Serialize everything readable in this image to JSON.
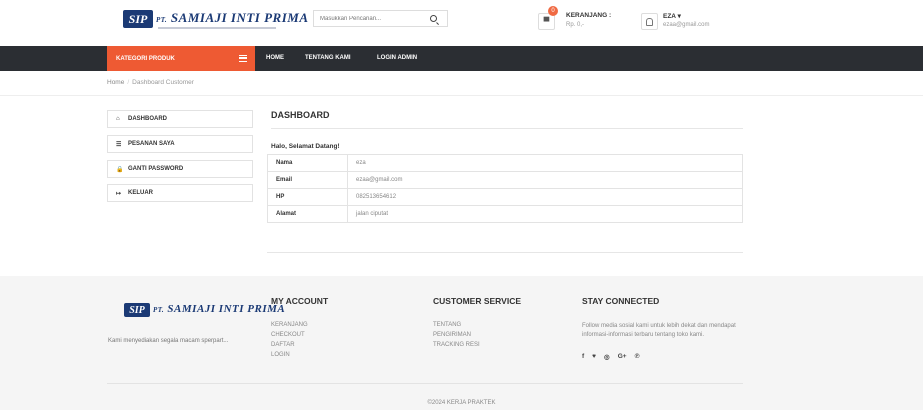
{
  "header": {
    "logo_box": "SIP",
    "logo_prefix": "PT.",
    "logo_name": "SAMIAJI INTI PRIMA",
    "search_placeholder": "Masukkan Pencarian...",
    "cart": {
      "badge": "0",
      "title": "KERANJANG :",
      "price": "Rp. 0,-"
    },
    "user": {
      "name": "EZA ▾",
      "email": "ezaa@gmail.com"
    }
  },
  "nav": {
    "category": "KATEGORI PRODUK",
    "links": [
      "HOME",
      "TENTANG KAMI",
      "LOGIN ADMIN"
    ]
  },
  "breadcrumb": {
    "home": "Home",
    "sep": "/",
    "current": "Dashboard Customer"
  },
  "sidebar": {
    "items": [
      {
        "icon": "home-icon",
        "glyph": "⌂",
        "label": "DASHBOARD"
      },
      {
        "icon": "list-icon",
        "glyph": "☰",
        "label": "PESANAN SAYA"
      },
      {
        "icon": "lock-icon",
        "glyph": "🔒",
        "label": "GANTI PASSWORD"
      },
      {
        "icon": "logout-icon",
        "glyph": "↦",
        "label": "KELUAR"
      }
    ]
  },
  "main": {
    "title": "DASHBOARD",
    "greeting": "Halo, Selamat Datang!",
    "rows": [
      {
        "key": "Nama",
        "value": "eza"
      },
      {
        "key": "Email",
        "value": "ezaa@gmail.com"
      },
      {
        "key": "HP",
        "value": "082513654612"
      },
      {
        "key": "Alamat",
        "value": "jalan ciputat"
      }
    ]
  },
  "footer": {
    "tagline": "Kami menyediakan segala macam sperpart...",
    "account_title": "MY ACCOUNT",
    "account_links": [
      "KERANJANG",
      "CHECKOUT",
      "DAFTAR",
      "LOGIN"
    ],
    "service_title": "CUSTOMER SERVICE",
    "service_links": [
      "TENTANG",
      "PENGIRIMAN",
      "TRACKING RESI"
    ],
    "connect_title": "STAY CONNECTED",
    "connect_desc": "Follow media sosial kami untuk lebih dekat dan mendapat informasi-informasi terbaru tentang toko kami.",
    "socials": [
      "f",
      "♥",
      "◎",
      "G+",
      "℗"
    ],
    "copyright": "©2024 KERJA PRAKTEK"
  },
  "colors": {
    "accent": "#ee5a33",
    "nav_bg": "#2b2e33",
    "brand": "#1b3a75"
  }
}
